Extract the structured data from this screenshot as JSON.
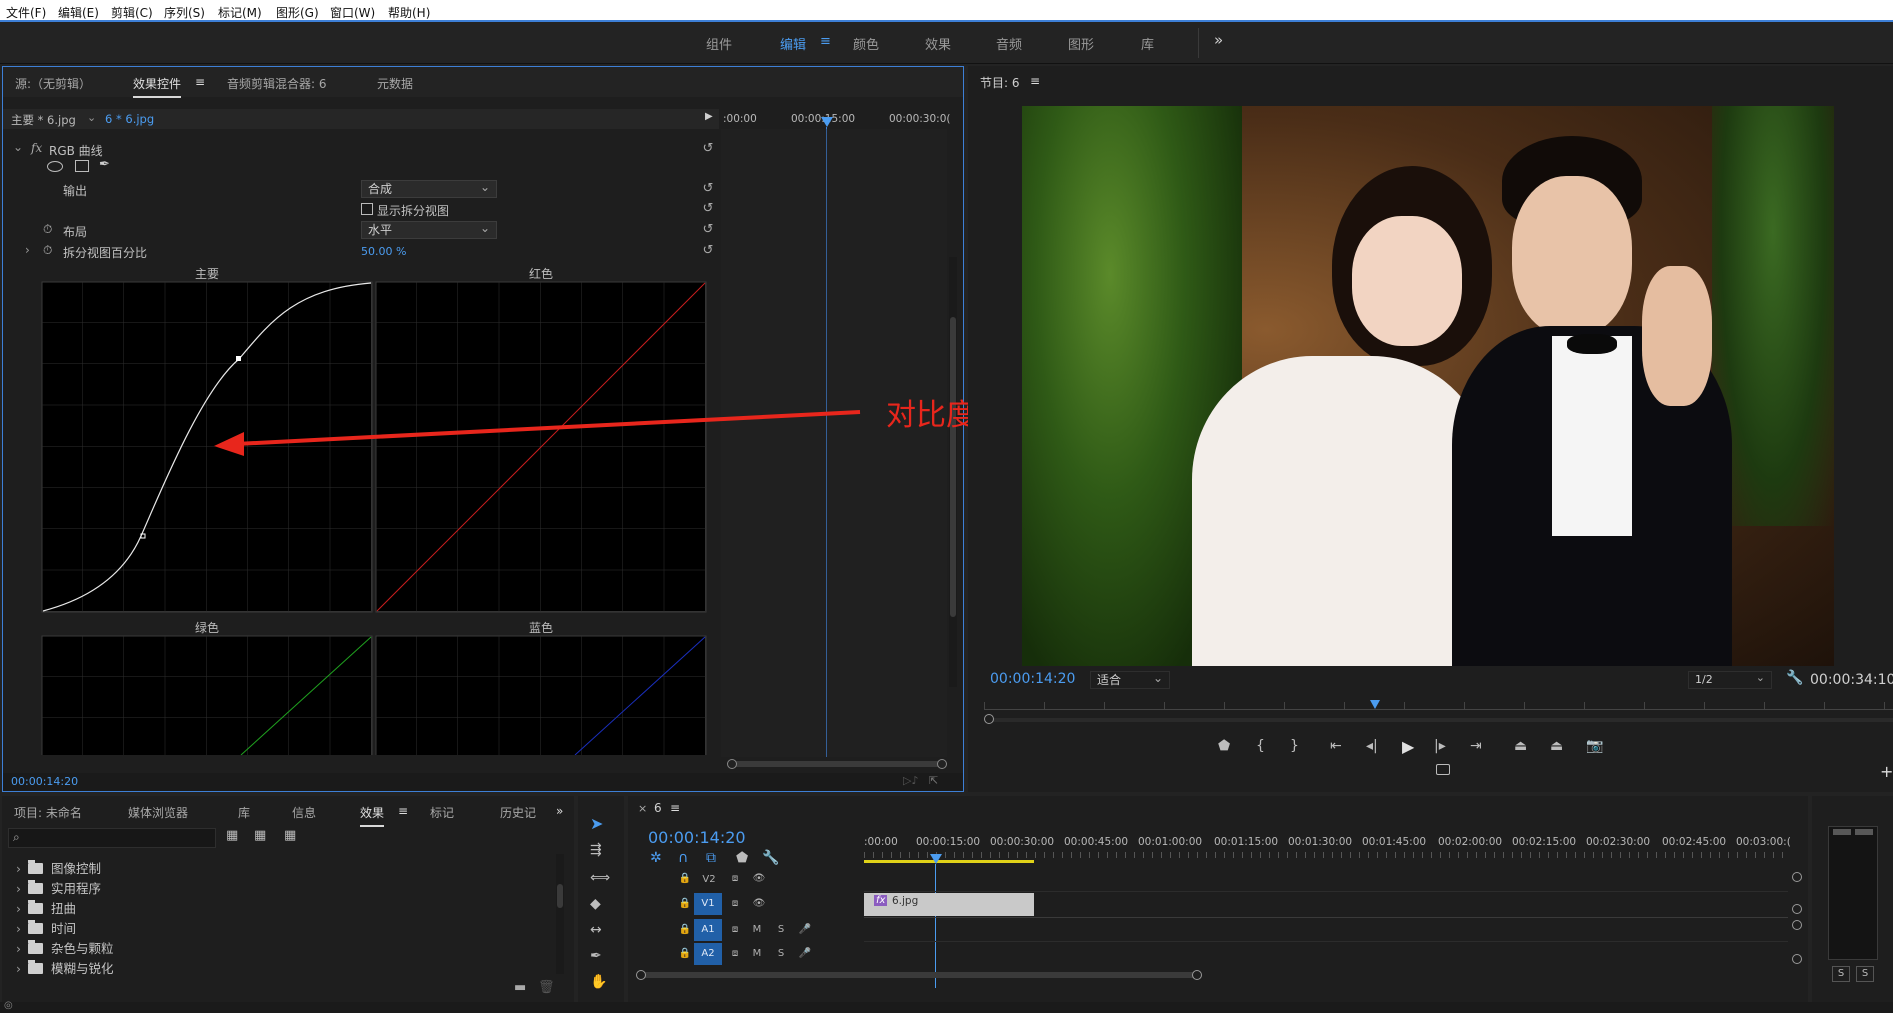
{
  "menu": [
    "文件(F)",
    "编辑(E)",
    "剪辑(C)",
    "序列(S)",
    "标记(M)",
    "图形(G)",
    "窗口(W)",
    "帮助(H)"
  ],
  "workspace_tabs": [
    "组件",
    "编辑",
    "颜色",
    "效果",
    "音频",
    "图形",
    "库"
  ],
  "workspace_active": "编辑",
  "workspace_more": "»",
  "source_panel": {
    "tabs": [
      "源:（无剪辑）",
      "效果控件",
      "音频剪辑混合器: 6",
      "元数据"
    ],
    "active_tab": "效果控件",
    "clip_master": "主要 * 6.jpg",
    "clip_current": "6 * 6.jpg",
    "timeline_labels": [
      ":00:00",
      "00:00:15:00",
      "00:00:30:0("
    ],
    "effect_name": "RGB 曲线",
    "fx_label": "fx",
    "output_label": "输出",
    "output_value": "合成",
    "split_view_label": "显示拆分视图",
    "layout_label": "布局",
    "layout_value": "水平",
    "split_percent_label": "拆分视图百分比",
    "split_percent_value": "50.00 %",
    "graphs": {
      "master": "主要",
      "red": "红色",
      "green": "绿色",
      "blue": "蓝色"
    },
    "bottom_timecode": "00:00:14:20"
  },
  "annotation": {
    "text": "对比度特别明显",
    "color": "#e8261c"
  },
  "program_panel": {
    "title": "节目: 6",
    "timecode": "00:00:14:20",
    "fit_value": "适合",
    "resolution_value": "1/2",
    "duration": "00:00:34:10"
  },
  "project_panel": {
    "tabs": [
      "项目: 未命名",
      "媒体浏览器",
      "库",
      "信息",
      "效果",
      "标记",
      "历史记"
    ],
    "active_tab": "效果",
    "search_placeholder": "",
    "folders": [
      "图像控制",
      "实用程序",
      "扭曲",
      "时间",
      "杂色与颗粒",
      "模糊与锐化"
    ]
  },
  "timeline_panel": {
    "sequence_name": "6",
    "timecode": "00:00:14:20",
    "ruler": [
      ":00:00",
      "00:00:15:00",
      "00:00:30:00",
      "00:00:45:00",
      "00:01:00:00",
      "00:01:15:00",
      "00:01:30:00",
      "00:01:45:00",
      "00:02:00:00",
      "00:02:15:00",
      "00:02:30:00",
      "00:02:45:00",
      "00:03:00:("
    ],
    "tracks": [
      {
        "name": "V2",
        "type": "video"
      },
      {
        "name": "V1",
        "type": "video"
      },
      {
        "name": "A1",
        "type": "audio"
      },
      {
        "name": "A2",
        "type": "audio"
      }
    ],
    "clip": {
      "label": "6.jpg",
      "fx": "fx",
      "track": "V1"
    }
  },
  "audio_meter": {
    "solo_labels": [
      "S",
      "S"
    ]
  },
  "colors": {
    "accent_blue": "#4b9cf0",
    "panel_bg": "#1e1e1e",
    "clip_bg": "#c9c9c9"
  }
}
